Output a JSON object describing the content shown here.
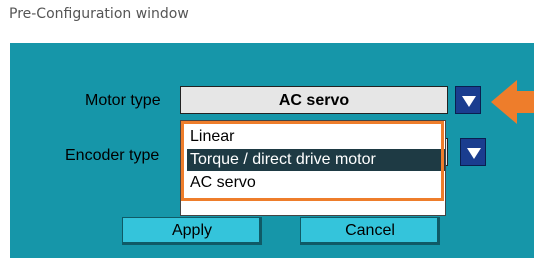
{
  "window": {
    "title": "Pre-Configuration window"
  },
  "form": {
    "motor_type_label": "Motor type",
    "motor_type_value": "AC servo",
    "encoder_type_label": "Encoder type"
  },
  "dropdown": {
    "options": [
      "Linear",
      "Torque / direct drive motor",
      "AC servo"
    ],
    "highlighted_option": "Torque / direct drive motor"
  },
  "buttons": {
    "apply": "Apply",
    "cancel": "Cancel"
  },
  "colors": {
    "panel": "#1696a9",
    "annotation": "#ee7d2b",
    "dropdown_button": "#1a3d8f",
    "selection": "#1e3a44"
  },
  "icons": [
    "chevron-down-icon",
    "orange-arrow-icon"
  ]
}
